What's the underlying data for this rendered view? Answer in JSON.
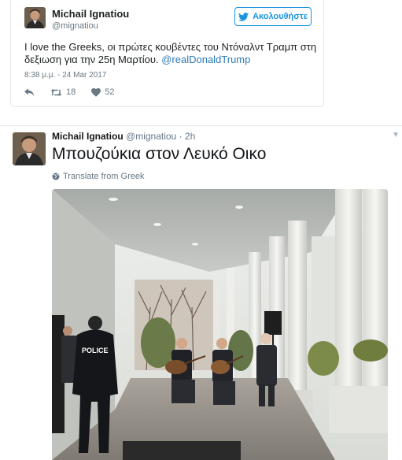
{
  "embed_tweet": {
    "author_name": "Michail Ignatiou",
    "author_handle": "@mignatiou",
    "follow_label": "Ακολουθήστε",
    "text_line1": "I love the Greeks, οι πρώτες κουβέντες του Ντόναλντ Τραμπ στη",
    "text_line2": "δεξιωση για την 25η Μαρτίου.",
    "mention": "@realDonaldTrump",
    "timestamp": "8:38 μ.μ. - 24 Mar 2017",
    "retweets": "18",
    "likes": "52",
    "icons": [
      "reply-icon",
      "retweet-icon",
      "heart-icon",
      "twitter-bird-icon"
    ]
  },
  "tweet": {
    "author_name": "Michail Ignatiou",
    "author_handle": "@mignatiou",
    "time": "2h",
    "text": "Μπουζούκια στον Λευκό Οικο",
    "translate_label": "Translate from Greek",
    "photo_label": "POLICE",
    "icons": [
      "globe-icon",
      "chevron-down-icon"
    ]
  },
  "colors": {
    "twitter_blue": "#1b95e0",
    "link_blue": "#2b7bb9",
    "muted_gray": "#697882",
    "border": "#e1e8ed"
  }
}
